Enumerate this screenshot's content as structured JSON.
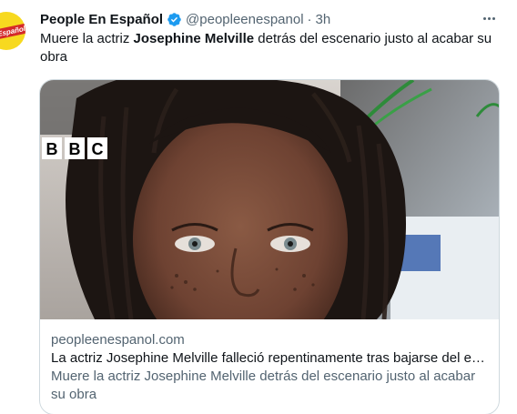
{
  "tweet": {
    "author_name": "People En Español",
    "handle": "@peopleenespanol",
    "separator": "·",
    "time": "3h",
    "avatar_logo_text": "Español",
    "text_before": "Muere la actriz ",
    "text_bold": "Josephine Melville",
    "text_after": " detrás del escenario justo al acabar su obra"
  },
  "card": {
    "image_logo": "BBC",
    "domain": "peopleenespanol.com",
    "title": "La actriz Josephine Melville falleció repentinamente tras bajarse del es…",
    "description": "Muere la actriz Josephine Melville detrás del escenario justo al acabar su obra"
  },
  "colors": {
    "verified": "#1d9bf0",
    "secondary_text": "#536471",
    "card_border": "#cfd9de"
  },
  "icons": [
    "verified-badge-icon",
    "more-options-icon"
  ]
}
